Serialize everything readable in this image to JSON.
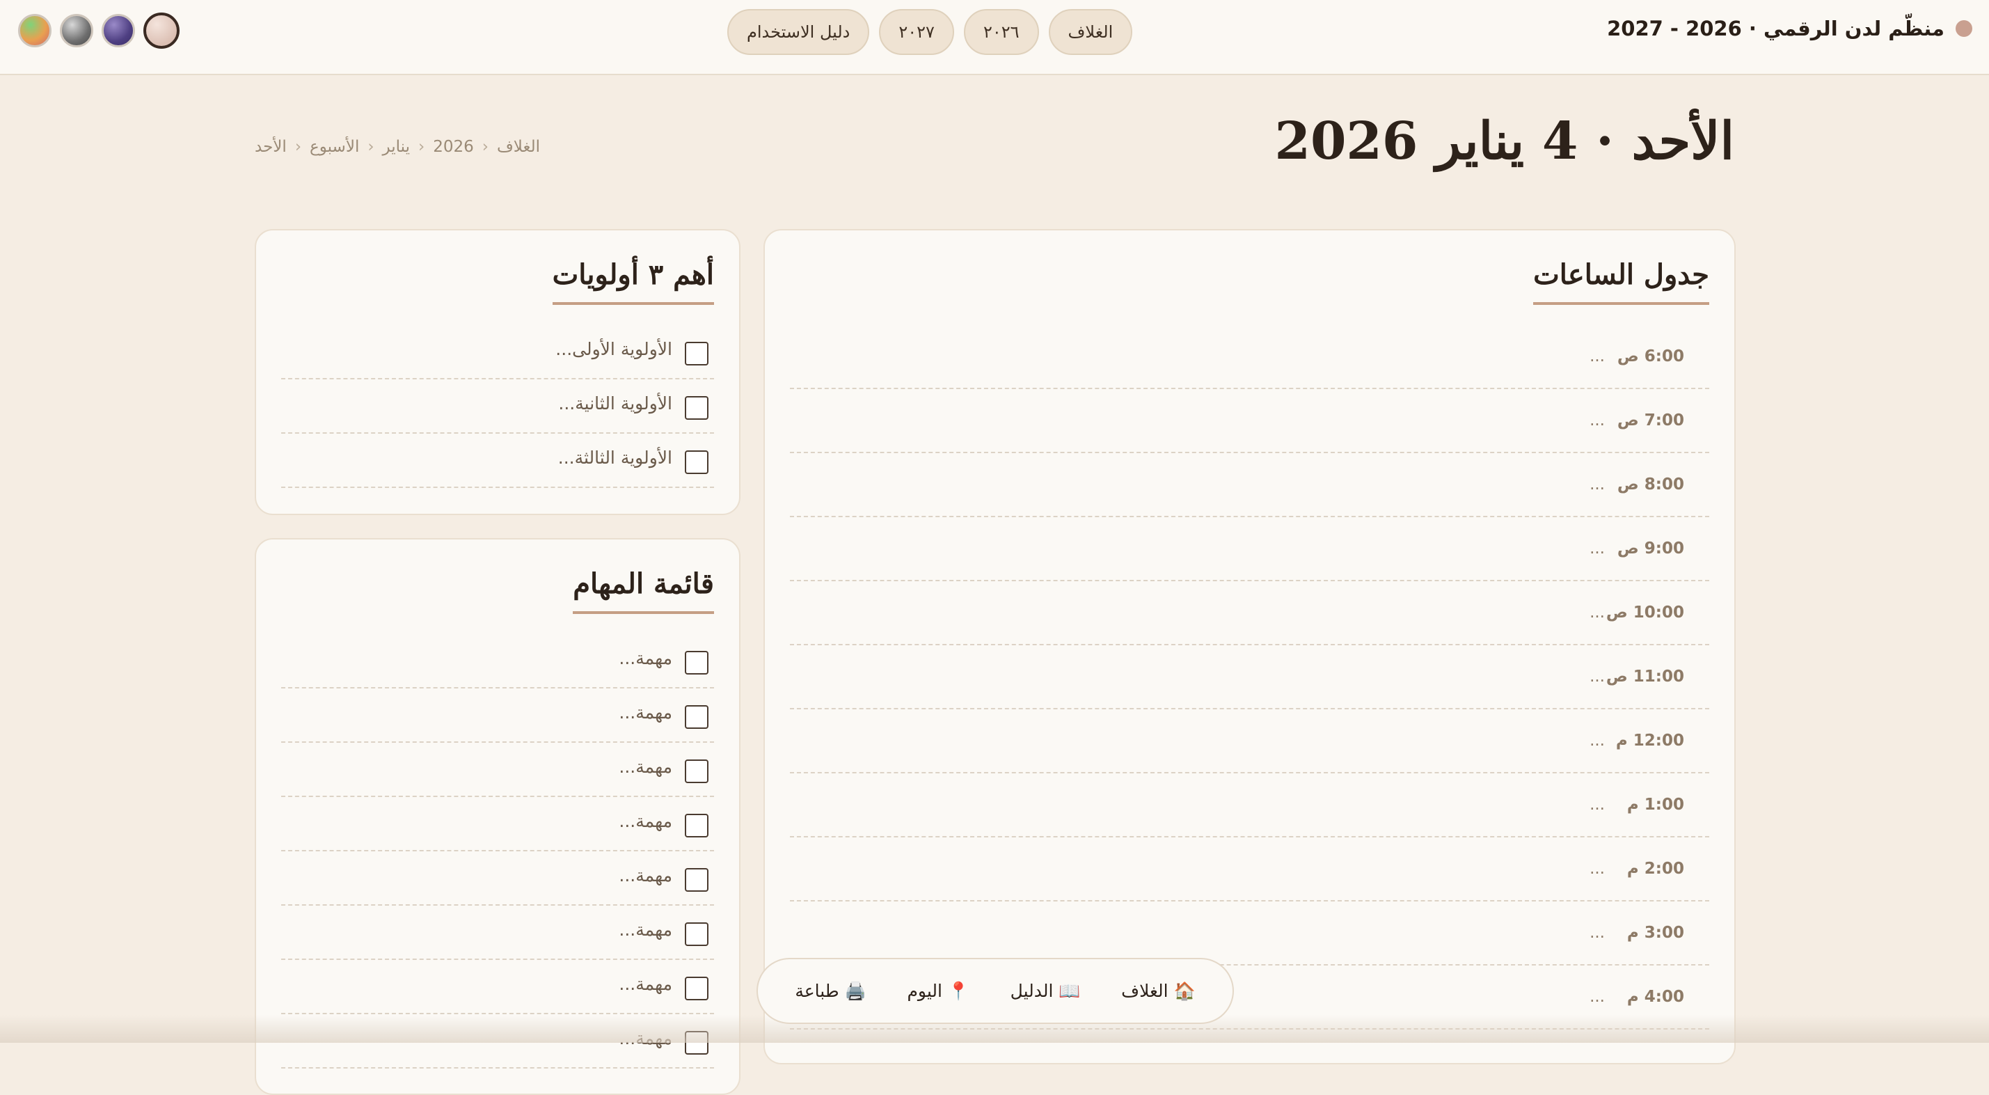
{
  "header": {
    "title": "منظّم لدن الرقمي · 2026 - 2027",
    "nav": [
      "الغلاف",
      "٢٠٢٦",
      "٢٠٢٧",
      "دليل الاستخدام"
    ],
    "themes": [
      {
        "name": "rose",
        "color": "#e8d0c6"
      },
      {
        "name": "purple",
        "color": "#5b4a8a"
      },
      {
        "name": "gray",
        "color": "#7a7a7a"
      },
      {
        "name": "rainbow",
        "color": "#e9a050"
      }
    ]
  },
  "page": {
    "title": "الأحد · 4 يناير 2026",
    "breadcrumb": [
      "الغلاف",
      "2026",
      "يناير",
      "الأسبوع",
      "الأحد"
    ]
  },
  "schedule": {
    "title": "جدول الساعات",
    "hours": [
      {
        "label": "6:00 ص",
        "value": "..."
      },
      {
        "label": "7:00 ص",
        "value": "..."
      },
      {
        "label": "8:00 ص",
        "value": "..."
      },
      {
        "label": "9:00 ص",
        "value": "..."
      },
      {
        "label": "10:00 ص",
        "value": "..."
      },
      {
        "label": "11:00 ص",
        "value": "..."
      },
      {
        "label": "12:00 م",
        "value": "..."
      },
      {
        "label": "1:00 م",
        "value": "..."
      },
      {
        "label": "2:00 م",
        "value": "..."
      },
      {
        "label": "3:00 م",
        "value": "..."
      },
      {
        "label": "4:00 م",
        "value": "..."
      }
    ]
  },
  "priorities": {
    "title": "أهم ٣ أولويات",
    "items": [
      "الأولوية الأولى...",
      "الأولوية الثانية...",
      "الأولوية الثالثة..."
    ]
  },
  "tasks": {
    "title": "قائمة المهام",
    "items": [
      "مهمة...",
      "مهمة...",
      "مهمة...",
      "مهمة...",
      "مهمة...",
      "مهمة...",
      "مهمة...",
      "مهمة..."
    ]
  },
  "dock": [
    "🏠 الغلاف",
    "📖 الدليل",
    "📍 اليوم",
    "🖨️ طباعة"
  ]
}
